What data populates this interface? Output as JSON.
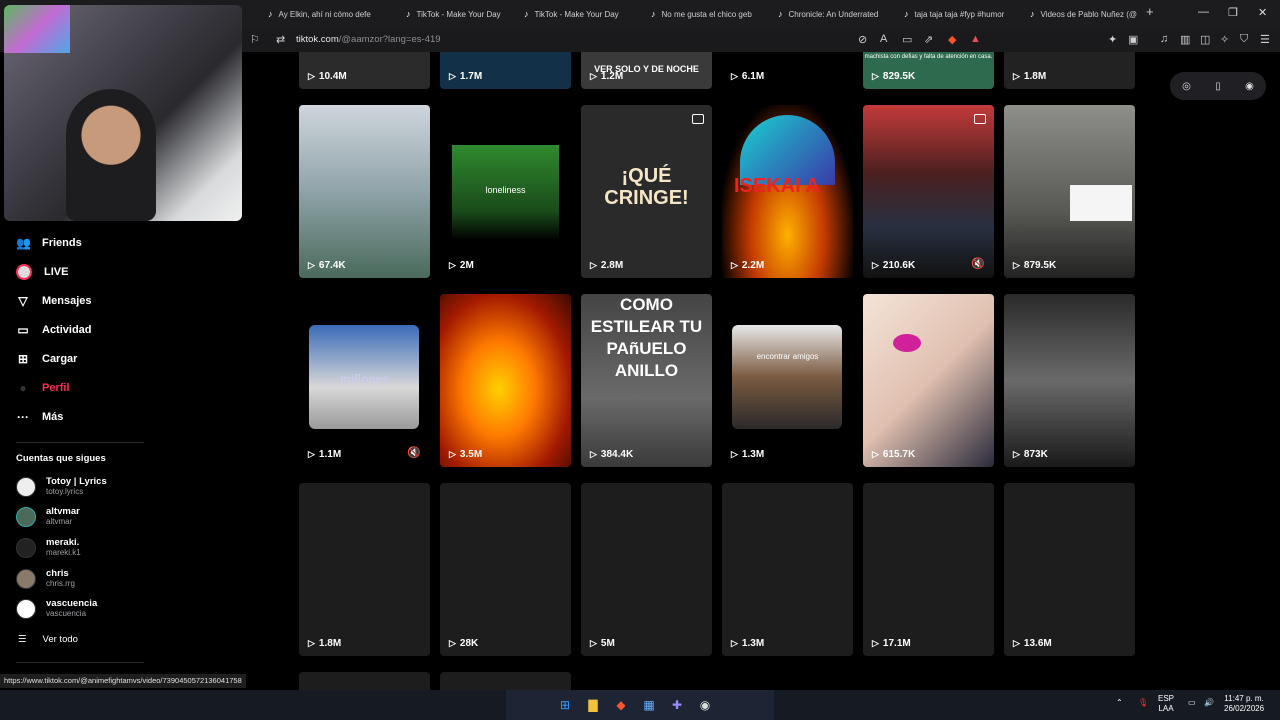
{
  "browser": {
    "tabs": [
      {
        "label": "Ay Elkin, ahí ni cómo defe"
      },
      {
        "label": "TikTok - Make Your Day"
      },
      {
        "label": "TikTok - Make Your Day"
      },
      {
        "label": "No me gusta el chico geb"
      },
      {
        "label": "Chronicle: An Underrated"
      },
      {
        "label": "taja taja taja #fyp #humor"
      },
      {
        "label": "Videos de Pablo Nuñez (@"
      }
    ],
    "url_host": "tiktok.com",
    "url_path": "/@aamzor?lang=es-419",
    "status_url": "https://www.tiktok.com/@animefightamvs/video/7390450572136041758"
  },
  "sidebar": {
    "nav": [
      {
        "label": "Friends",
        "icon": "friends-icon",
        "glyph": "👥"
      },
      {
        "label": "LIVE",
        "icon": "live-icon",
        "glyph": ""
      },
      {
        "label": "Mensajes",
        "icon": "messages-icon",
        "glyph": "▽"
      },
      {
        "label": "Actividad",
        "icon": "activity-icon",
        "glyph": "▭"
      },
      {
        "label": "Cargar",
        "icon": "upload-icon",
        "glyph": "⊞"
      },
      {
        "label": "Perfil",
        "icon": "profile-icon",
        "glyph": "●"
      },
      {
        "label": "Más",
        "icon": "more-icon",
        "glyph": "···"
      }
    ],
    "following_title": "Cuentas que sigues",
    "following": [
      {
        "name": "Totoy | Lyrics",
        "handle": "totoy.lyrics"
      },
      {
        "name": "altvmar",
        "handle": "altvmar"
      },
      {
        "name": "meraki.",
        "handle": "mareki.k1"
      },
      {
        "name": "chris",
        "handle": "chris.rrg"
      },
      {
        "name": "vascuencia",
        "handle": "vascuencia"
      }
    ],
    "see_all": "Ver todo"
  },
  "grid": {
    "row0": [
      "10.4M",
      "1.7M",
      "1.2M",
      "6.1M",
      "829.5K",
      "1.8M"
    ],
    "row0_captions": [
      "",
      "",
      "VER SOLO Y DE NOCHE",
      "",
      "machista con defias y falta de atención en casa.",
      ""
    ],
    "row1": [
      "67.4K",
      "2M",
      "2.8M",
      "2.2M",
      "210.6K",
      "879.5K"
    ],
    "row1_captions": [
      "",
      "loneliness",
      "¡QUÉ CRINGE!",
      "ISEKAI A",
      "",
      ""
    ],
    "row2": [
      "1.1M",
      "3.5M",
      "384.4K",
      "1.3M",
      "615.7K",
      "873K"
    ],
    "row2_captions": [
      "millones",
      "",
      "COMO ESTILEAR TU PAñUELO ANILLO",
      "encontrar amigos",
      "",
      ""
    ],
    "row3": [
      "1.8M",
      "28K",
      "5M",
      "1.3M",
      "17.1M",
      "13.6M"
    ]
  },
  "taskbar": {
    "lang": "ESP",
    "lang2": "LAA",
    "time": "11:47 p. m.",
    "date": "26/02/2026"
  },
  "colors": {
    "accent": "#fe2c55",
    "background": "#000000"
  }
}
